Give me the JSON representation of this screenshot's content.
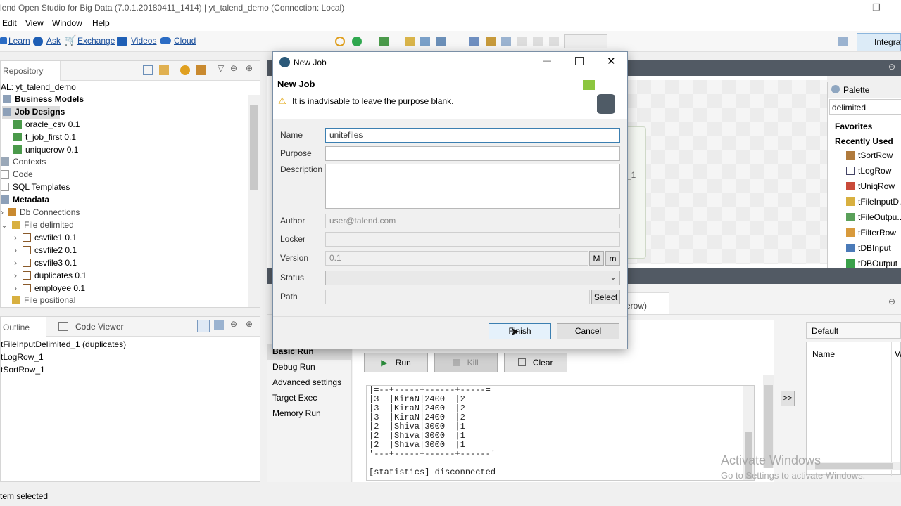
{
  "window": {
    "title": "lend Open Studio for Big Data (7.0.1.20180411_1414) | yt_talend_demo (Connection: Local)",
    "min": "—",
    "max": "❐",
    "close": "✕"
  },
  "menu": [
    "Edit",
    "Window",
    "Help"
  ],
  "menu_left": "t",
  "links": {
    "learn": "Learn",
    "ask": "Ask",
    "exchange": "Exchange",
    "videos": "Videos",
    "cloud": "Cloud"
  },
  "perspective": "Integrat",
  "repository": {
    "tab": "Repository",
    "root": "AL: yt_talend_demo",
    "items": [
      {
        "label": "Business Models",
        "bold": true
      },
      {
        "label": "Job Designs",
        "bold": true
      },
      {
        "label": "oracle_csv 0.1"
      },
      {
        "label": "t_job_first 0.1"
      },
      {
        "label": "uniquerow 0.1"
      },
      {
        "label": "Contexts"
      },
      {
        "label": "Code"
      },
      {
        "label": "SQL Templates"
      },
      {
        "label": "Metadata",
        "bold": true
      },
      {
        "label": "Db Connections"
      },
      {
        "label": "File delimited"
      },
      {
        "label": "csvfile1 0.1"
      },
      {
        "label": "csvfile2 0.1"
      },
      {
        "label": "csvfile3 0.1"
      },
      {
        "label": "duplicates 0.1"
      },
      {
        "label": "employee 0.1"
      },
      {
        "label": "File positional"
      }
    ]
  },
  "outline": {
    "tab": "Outline",
    "tab2": "Code Viewer",
    "items": [
      "tFileInputDelimited_1 (duplicates)",
      "tLogRow_1",
      "tSortRow_1"
    ]
  },
  "status_bar": "tem selected",
  "palette": {
    "tab": "Palette",
    "search": "delimited",
    "favorites": "Favorites",
    "recent": "Recently Used",
    "items": [
      "tSortRow",
      "tLogRow",
      "tUniqRow",
      "tFileInputD...",
      "tFileOutpu...",
      "tFilterRow",
      "tDBInput",
      "tDBOutput"
    ]
  },
  "canvas_fragment": "_1",
  "run": {
    "tab_fragment": "erow)",
    "side_tabs": [
      "Basic Run",
      "Debug Run",
      "Advanced settings",
      "Target Exec",
      "Memory Run"
    ],
    "run_label": "Run",
    "kill_label": "Kill",
    "clear_label": "Clear",
    "console_lines": [
      "|=--+-----+------+-----=|",
      "|3  |KiraN|2400  |2     |",
      "|3  |KiraN|2400  |2     |",
      "|3  |KiraN|2400  |2     |",
      "|2  |Shiva|3000  |1     |",
      "|2  |Shiva|3000  |1     |",
      "|2  |Shiva|3000  |1     |",
      "'---+-----+------+------'",
      "",
      "[statistics] disconnected"
    ],
    "move_btn": ">>",
    "context": "Default",
    "ctx_col1": "Name",
    "ctx_col2": "Va"
  },
  "dialog": {
    "title": "New Job",
    "heading": "New Job",
    "warning": "It is inadvisable to leave the purpose blank.",
    "labels": {
      "name": "Name",
      "purpose": "Purpose",
      "description": "Description",
      "author": "Author",
      "locker": "Locker",
      "version": "Version",
      "status": "Status",
      "path": "Path"
    },
    "values": {
      "name": "unitefiles",
      "purpose": "",
      "description": "",
      "author": "user@talend.com",
      "locker": "",
      "version": "0.1",
      "status": "",
      "path": ""
    },
    "btn_major": "M",
    "btn_minor": "m",
    "btn_select": "Select",
    "finish": "Finish",
    "cancel": "Cancel"
  },
  "watermark": {
    "line1": "Activate Windows",
    "line2": "Go to Settings to activate Windows."
  }
}
